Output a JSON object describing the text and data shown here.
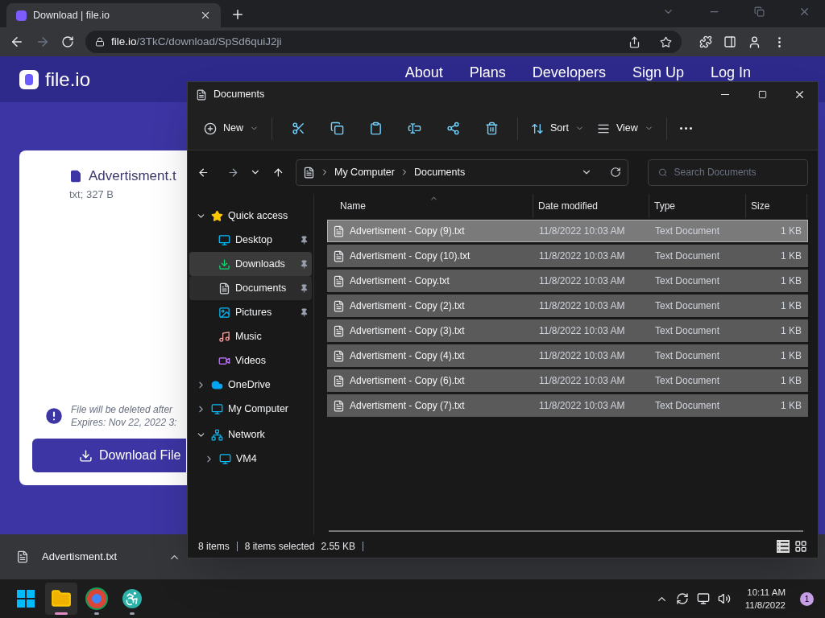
{
  "browser": {
    "tabs": [
      {
        "title": "Download | file.io",
        "selected": true
      }
    ],
    "url_host": "file.io",
    "url_path": "/3TkC/download/SpSd6quiJ2ji"
  },
  "site": {
    "logo": "file.io",
    "nav": [
      "About",
      "Plans",
      "Developers",
      "Sign Up",
      "Log In"
    ],
    "file_name": "Advertisment.t",
    "file_meta": "txt; 327 B",
    "notice": [
      "File will be deleted after",
      "Expires: Nov 22, 2022 3:"
    ],
    "download_button": "Download File"
  },
  "download_bar": {
    "file": "Advertisment.txt"
  },
  "explorer": {
    "title": "Documents",
    "toolbar": [
      {
        "kind": "new",
        "label": "New"
      },
      {
        "kind": "cut"
      },
      {
        "kind": "copy"
      },
      {
        "kind": "paste"
      },
      {
        "kind": "rename"
      },
      {
        "kind": "share"
      },
      {
        "kind": "delete"
      },
      {
        "kind": "sort",
        "label": "Sort"
      },
      {
        "kind": "view",
        "label": "View"
      },
      {
        "kind": "more"
      }
    ],
    "breadcrumb": [
      "My Computer",
      "Documents"
    ],
    "search_placeholder": "Search Documents",
    "sidebar": [
      {
        "label": "Quick access",
        "expanded": true,
        "selected": false,
        "children": [
          {
            "label": "Desktop",
            "pinned": true,
            "selected": false
          },
          {
            "label": "Downloads",
            "pinned": true,
            "selected": true
          },
          {
            "label": "Documents",
            "pinned": true,
            "selected": false,
            "hovered": true
          },
          {
            "label": "Pictures",
            "pinned": true,
            "selected": false
          },
          {
            "label": "Music",
            "pinned": false,
            "selected": false
          },
          {
            "label": "Videos",
            "pinned": false,
            "selected": false
          }
        ]
      },
      {
        "label": "OneDrive",
        "expanded": false,
        "selected": false
      },
      {
        "label": "My Computer",
        "expanded": false,
        "selected": false
      },
      {
        "label": "Network",
        "expanded": true,
        "selected": false,
        "children": [
          {
            "label": "VM4",
            "expanded": false,
            "selected": false
          }
        ]
      }
    ],
    "columns": [
      "Name",
      "Date modified",
      "Type",
      "Size"
    ],
    "files": [
      {
        "name": "Advertisment - Copy (9).txt",
        "date": "11/8/2022 10:03 AM",
        "type": "Text Document",
        "size": "1 KB",
        "selected": true,
        "focused": true
      },
      {
        "name": "Advertisment - Copy (10).txt",
        "date": "11/8/2022 10:03 AM",
        "type": "Text Document",
        "size": "1 KB",
        "selected": true,
        "focused": false
      },
      {
        "name": "Advertisment - Copy.txt",
        "date": "11/8/2022 10:03 AM",
        "type": "Text Document",
        "size": "1 KB",
        "selected": true,
        "focused": false
      },
      {
        "name": "Advertisment - Copy (2).txt",
        "date": "11/8/2022 10:03 AM",
        "type": "Text Document",
        "size": "1 KB",
        "selected": true,
        "focused": false
      },
      {
        "name": "Advertisment - Copy (3).txt",
        "date": "11/8/2022 10:03 AM",
        "type": "Text Document",
        "size": "1 KB",
        "selected": true,
        "focused": false
      },
      {
        "name": "Advertisment - Copy (4).txt",
        "date": "11/8/2022 10:03 AM",
        "type": "Text Document",
        "size": "1 KB",
        "selected": true,
        "focused": false
      },
      {
        "name": "Advertisment - Copy (6).txt",
        "date": "11/8/2022 10:03 AM",
        "type": "Text Document",
        "size": "1 KB",
        "selected": true,
        "focused": false
      },
      {
        "name": "Advertisment - Copy (7).txt",
        "date": "11/8/2022 10:03 AM",
        "type": "Text Document",
        "size": "1 KB",
        "selected": true,
        "focused": false
      }
    ],
    "status": {
      "count": "8 items",
      "selection": "8 items selected",
      "size": "2.55 KB"
    }
  },
  "taskbar": {
    "apps": [
      {
        "kind": "explorer",
        "selected": true
      },
      {
        "kind": "chrome",
        "selected": false
      },
      {
        "kind": "accessibility",
        "selected": false
      }
    ],
    "time": "10:11 AM",
    "date": "11/8/2022",
    "notifications": "1"
  }
}
